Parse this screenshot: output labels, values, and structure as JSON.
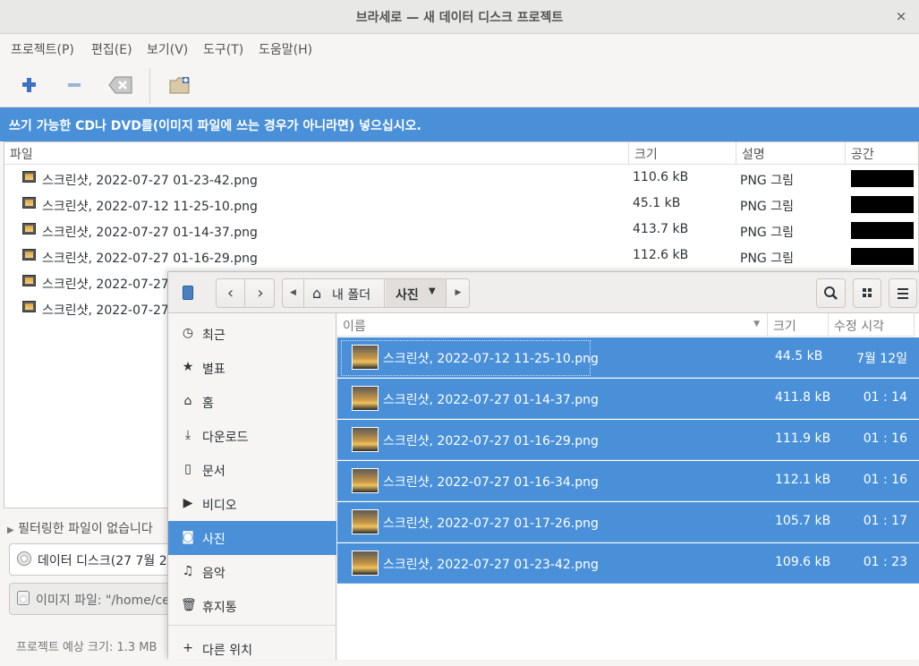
{
  "window": {
    "title": "브라세로 — 새 데이터 디스크 프로젝트",
    "close_glyph": "×"
  },
  "menu": [
    "프로젝트(P)",
    "편집(E)",
    "보기(V)",
    "도구(T)",
    "도움말(H)"
  ],
  "toolbar": {
    "add_glyph": "+",
    "remove_glyph": "−",
    "clear_glyph": "⌫"
  },
  "infobar": {
    "message": "쓰기 가능한 CD나 DVD를(이미지 파일에 쓰는 경우가 아니라면) 넣으십시오."
  },
  "project_table": {
    "columns": [
      "파일",
      "크기",
      "설명",
      "공간"
    ],
    "rows": [
      {
        "name": "스크린샷, 2022-07-27 01-23-42.png",
        "size": "110.6 kB",
        "desc": "PNG 그림"
      },
      {
        "name": "스크린샷, 2022-07-12 11-25-10.png",
        "size": "45.1 kB",
        "desc": "PNG 그림"
      },
      {
        "name": "스크린샷, 2022-07-27 01-14-37.png",
        "size": "413.7 kB",
        "desc": "PNG 그림"
      },
      {
        "name": "스크린샷, 2022-07-27 01-16-29.png",
        "size": "112.6 kB",
        "desc": "PNG 그림"
      },
      {
        "name": "스크린샷, 2022-07-27",
        "size": "",
        "desc": ""
      },
      {
        "name": "스크린샷, 2022-07-27",
        "size": "",
        "desc": ""
      }
    ]
  },
  "bottom": {
    "filter_text": "필터링한 파일이 없습니다",
    "disc_label": "데이터 디스크(27  7월 2",
    "image_file": "이미지 파일: \"/home/ce",
    "estimate": "프로젝트 예상 크기: 1.3 MB"
  },
  "chooser": {
    "path_home": "내 폴더",
    "path_current": "사진",
    "sidebar": [
      {
        "icon": "recent-icon",
        "glyph": "◷",
        "label": "최근"
      },
      {
        "icon": "star-icon",
        "glyph": "★",
        "label": "별표"
      },
      {
        "icon": "home-icon",
        "glyph": "⌂",
        "label": "홈"
      },
      {
        "icon": "download-icon",
        "glyph": "⤓",
        "label": "다운로드"
      },
      {
        "icon": "document-icon",
        "glyph": "▯",
        "label": "문서"
      },
      {
        "icon": "video-icon",
        "glyph": "▶",
        "label": "비디오"
      },
      {
        "icon": "camera-icon",
        "glyph": "◙",
        "label": "사진",
        "active": true
      },
      {
        "icon": "music-icon",
        "glyph": "♫",
        "label": "음악"
      },
      {
        "icon": "trash-icon",
        "glyph": "🗑",
        "label": "휴지통"
      },
      {
        "icon": "plus-icon",
        "glyph": "+",
        "label": "다른 위치"
      }
    ],
    "columns": {
      "name": "이름",
      "size": "크기",
      "modified": "수정 시각"
    },
    "files": [
      {
        "name": "스크린샷, 2022-07-12 11-25-10.png",
        "size": "44.5 kB",
        "time": "7월 12일"
      },
      {
        "name": "스크린샷, 2022-07-27 01-14-37.png",
        "size": "411.8 kB",
        "time": "01 : 14"
      },
      {
        "name": "스크린샷, 2022-07-27 01-16-29.png",
        "size": "111.9 kB",
        "time": "01 : 16"
      },
      {
        "name": "스크린샷, 2022-07-27 01-16-34.png",
        "size": "112.1 kB",
        "time": "01 : 16"
      },
      {
        "name": "스크린샷, 2022-07-27 01-17-26.png",
        "size": "105.7 kB",
        "time": "01 : 17"
      },
      {
        "name": "스크린샷, 2022-07-27 01-23-42.png",
        "size": "109.6 kB",
        "time": "01 : 23"
      }
    ]
  }
}
